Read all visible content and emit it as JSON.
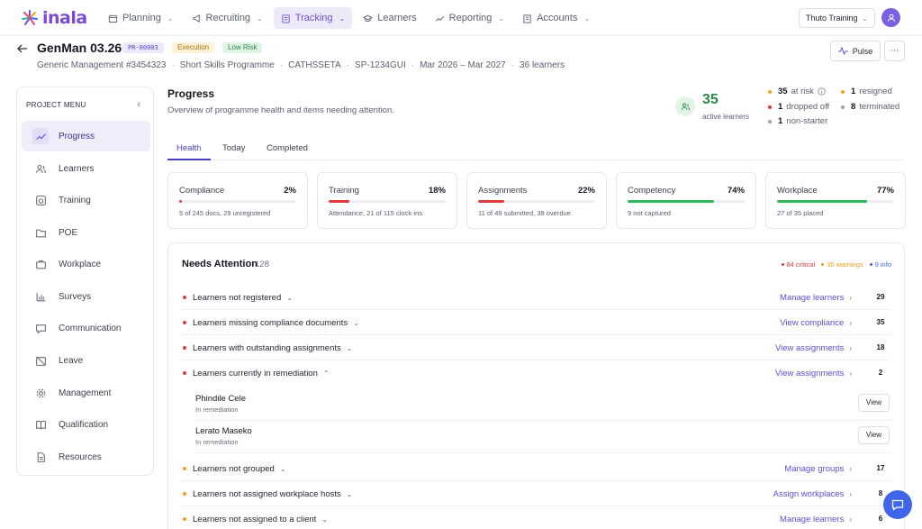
{
  "brand": {
    "name": "inala"
  },
  "nav": {
    "items": [
      {
        "label": "Planning",
        "icon": "calendar-icon",
        "dropdown": true
      },
      {
        "label": "Recruiting",
        "icon": "megaphone-icon",
        "dropdown": true
      },
      {
        "label": "Tracking",
        "icon": "clipboard-icon",
        "dropdown": true,
        "active": true
      },
      {
        "label": "Learners",
        "icon": "graduation-cap-icon",
        "dropdown": false
      },
      {
        "label": "Reporting",
        "icon": "chart-icon",
        "dropdown": true
      },
      {
        "label": "Accounts",
        "icon": "building-icon",
        "dropdown": true
      }
    ],
    "org_select": "Thuto Training"
  },
  "project": {
    "title": "GenMan 03.26",
    "code": "PR-00003",
    "status_badge": "Execution",
    "risk_badge": "Low Risk",
    "meta": [
      "Generic Management #3454323",
      "Short Skills Programme",
      "CATHSSETA",
      "SP-1234GUI",
      "Mar 2026 – Mar 2027",
      "36 learners"
    ],
    "pulse_label": "Pulse"
  },
  "sidebar": {
    "heading": "PROJECT MENU",
    "items": [
      {
        "label": "Progress",
        "icon": "trend-up-icon",
        "active": true
      },
      {
        "label": "Learners",
        "icon": "users-icon"
      },
      {
        "label": "Training",
        "icon": "training-icon"
      },
      {
        "label": "POE",
        "icon": "folder-icon"
      },
      {
        "label": "Workplace",
        "icon": "briefcase-icon"
      },
      {
        "label": "Surveys",
        "icon": "bar-chart-icon"
      },
      {
        "label": "Communication",
        "icon": "chat-bubble-icon"
      },
      {
        "label": "Leave",
        "icon": "calendar-off-icon"
      },
      {
        "label": "Management",
        "icon": "settings-icon"
      },
      {
        "label": "Qualification",
        "icon": "book-icon"
      },
      {
        "label": "Resources",
        "icon": "document-icon"
      }
    ]
  },
  "progress": {
    "title": "Progress",
    "subtitle": "Overview of programme health and items needing attention.",
    "active_count": "35",
    "active_label": "active learners",
    "stats": [
      {
        "num": "35",
        "label": "at risk",
        "color": "#f0a020",
        "info": true
      },
      {
        "num": "1",
        "label": "dropped off",
        "color": "#e03a3a"
      },
      {
        "num": "1",
        "label": "non-starter",
        "color": "#9aa0ab"
      },
      {
        "num": "1",
        "label": "resigned",
        "color": "#f0a020"
      },
      {
        "num": "8",
        "label": "terminated",
        "color": "#9aa0ab"
      }
    ]
  },
  "tabs": [
    "Health",
    "Today",
    "Completed"
  ],
  "cards": [
    {
      "label": "Compliance",
      "pct": "2%",
      "value": 2,
      "color": "#e03a3a",
      "sub": "5 of 245 docs, 29 unregistered"
    },
    {
      "label": "Training",
      "pct": "18%",
      "value": 18,
      "color": "#e03a3a",
      "sub": "Attendance, 21 of 115 clock-ins"
    },
    {
      "label": "Assignments",
      "pct": "22%",
      "value": 22,
      "color": "#e03a3a",
      "sub": "11 of 49 submitted, 38 overdue"
    },
    {
      "label": "Competency",
      "pct": "74%",
      "value": 74,
      "color": "#2fb55a",
      "sub": "9 not captured"
    },
    {
      "label": "Workplace",
      "pct": "77%",
      "value": 77,
      "color": "#2fb55a",
      "sub": "27 of 35 placed"
    }
  ],
  "attention": {
    "title": "Needs Attention",
    "count": "128",
    "legend": [
      {
        "text": "84 critical",
        "color": "#e03a3a"
      },
      {
        "text": "35 warnings",
        "color": "#f0a020"
      },
      {
        "text": "9 info",
        "color": "#3f66e8"
      }
    ],
    "rows": [
      {
        "label": "Learners not registered",
        "link": "Manage learners",
        "count": "29",
        "color": "#e03a3a"
      },
      {
        "label": "Learners missing compliance documents",
        "link": "View compliance",
        "count": "35",
        "color": "#e03a3a"
      },
      {
        "label": "Learners with outstanding assignments",
        "link": "View assignments",
        "count": "18",
        "color": "#e03a3a"
      },
      {
        "label": "Learners currently in remediation",
        "link": "View assignments",
        "count": "2",
        "color": "#e03a3a",
        "expanded": true
      },
      {
        "label": "Learners not grouped",
        "link": "Manage groups",
        "count": "17",
        "color": "#f0a020"
      },
      {
        "label": "Learners not assigned workplace hosts",
        "link": "Assign workplaces",
        "count": "8",
        "color": "#f0a020"
      },
      {
        "label": "Learners not assigned to a client",
        "link": "Manage learners",
        "count": "6",
        "color": "#f0a020"
      }
    ],
    "remediation_people": [
      {
        "name": "Phindile Cele",
        "status": "In remediation",
        "action": "View"
      },
      {
        "name": "Lerato Maseko",
        "status": "In remediation",
        "action": "View"
      }
    ]
  }
}
